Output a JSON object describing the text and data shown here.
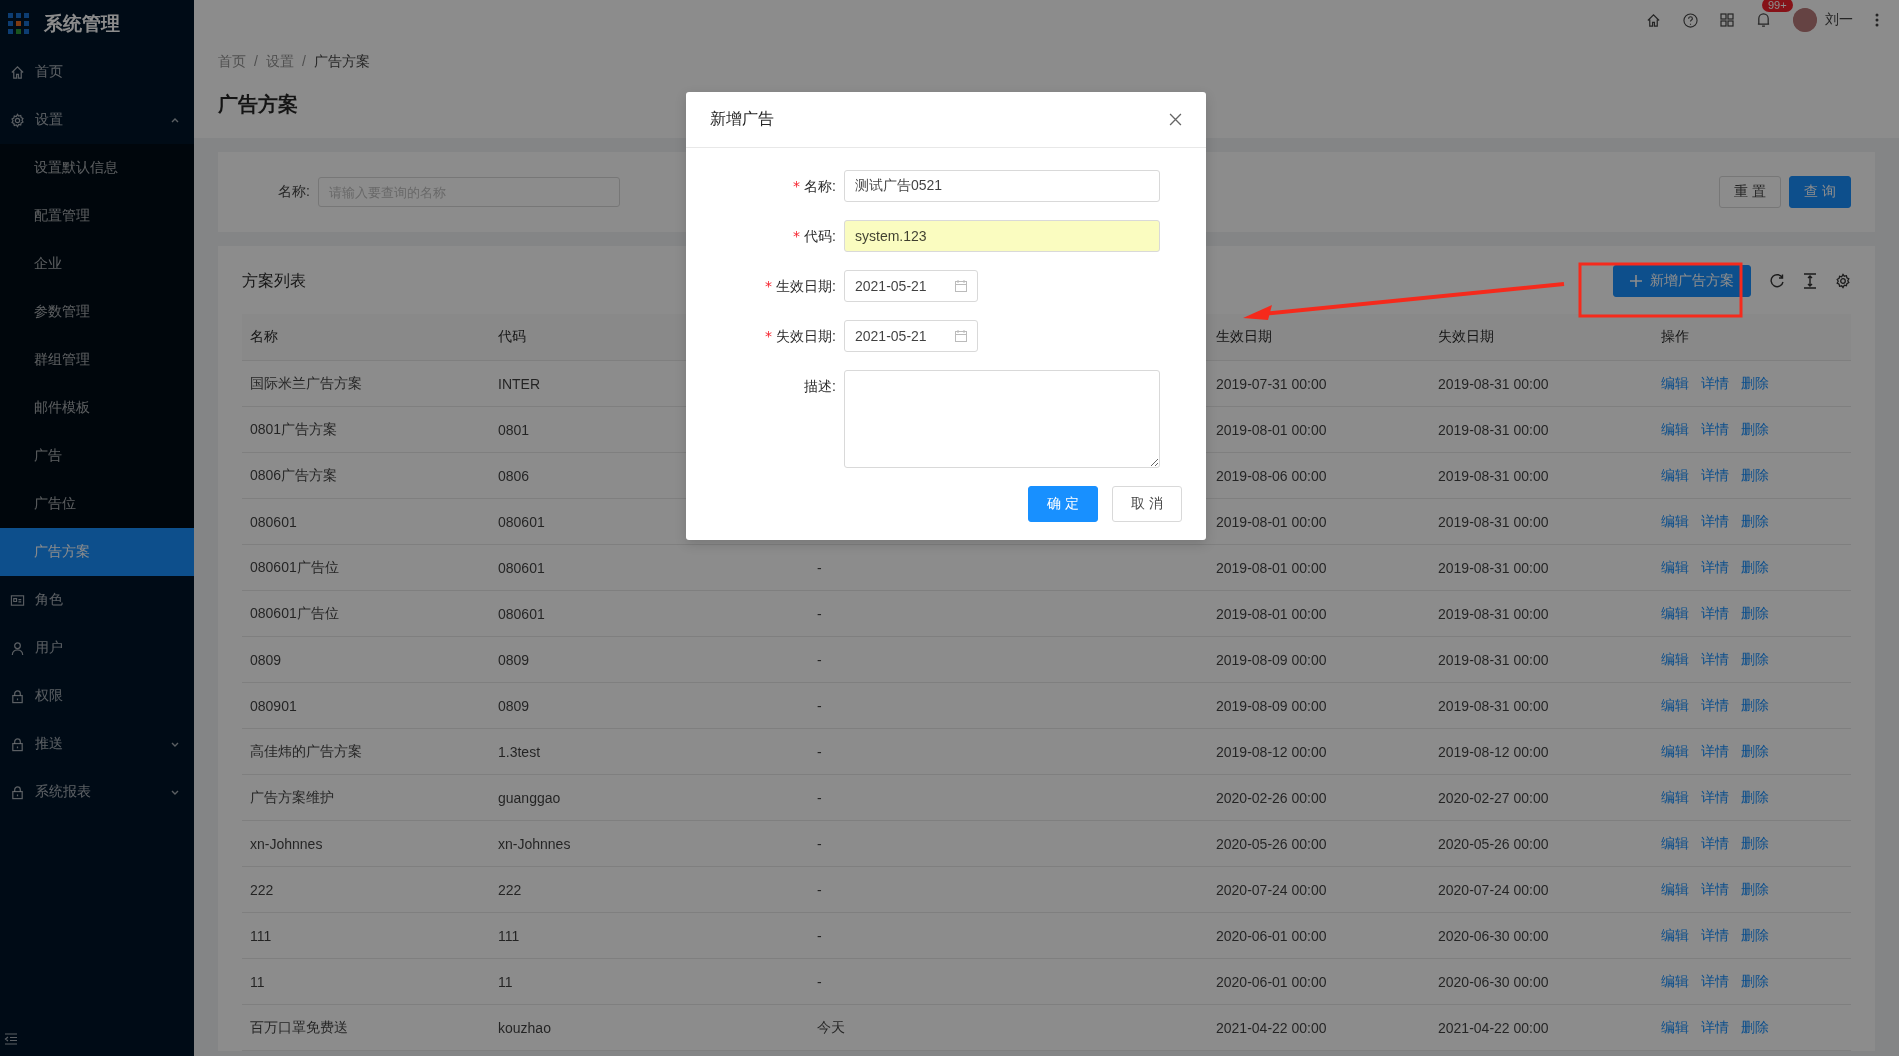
{
  "sidebar": {
    "title": "系统管理",
    "items": [
      {
        "label": "首页",
        "selected": false
      },
      {
        "label": "设置",
        "selected": false,
        "expanded": true,
        "children": [
          {
            "label": "设置默认信息",
            "selected": false
          },
          {
            "label": "配置管理",
            "selected": false
          },
          {
            "label": "企业",
            "selected": false
          },
          {
            "label": "参数管理",
            "selected": false
          },
          {
            "label": "群组管理",
            "selected": false
          },
          {
            "label": "邮件模板",
            "selected": false
          },
          {
            "label": "广告",
            "selected": false
          },
          {
            "label": "广告位",
            "selected": false
          },
          {
            "label": "广告方案",
            "selected": true
          }
        ]
      },
      {
        "label": "角色",
        "selected": false
      },
      {
        "label": "用户",
        "selected": false
      },
      {
        "label": "权限",
        "selected": false
      },
      {
        "label": "推送",
        "selected": false,
        "expanded": false
      },
      {
        "label": "系统报表",
        "selected": false,
        "expanded": false
      }
    ]
  },
  "header": {
    "notification_badge": "99+",
    "user_name": "刘一"
  },
  "breadcrumb": [
    {
      "label": "首页",
      "separator": "/"
    },
    {
      "label": "设置",
      "separator": "/"
    },
    {
      "label": "广告方案"
    }
  ],
  "page_title": "广告方案",
  "search": {
    "label": "名称:",
    "placeholder": "请输入要查询的名称",
    "buttons": [
      "重 置",
      "查 询"
    ]
  },
  "list": {
    "title": "方案列表",
    "add_button": "新增广告方案",
    "table": {
      "columns": [
        "名称",
        "代码",
        "生效日期",
        "失效日期",
        "操作"
      ],
      "rows": [
        {
          "name": "国际米兰广告方案",
          "code": "INTER",
          "start_date": "2019-07-31 00:00",
          "end_date": "2019-08-31 00:00",
          "actions": [
            "编辑",
            "详情",
            "删除"
          ]
        },
        {
          "name": "0801广告方案",
          "code": "0801",
          "start_date": "2019-08-01 00:00",
          "end_date": "2019-08-31 00:00",
          "actions": [
            "编辑",
            "详情",
            "删除"
          ]
        },
        {
          "name": "0806广告方案",
          "code": "0806",
          "start_date": "2019-08-06 00:00",
          "end_date": "2019-08-31 00:00",
          "actions": [
            "编辑",
            "详情",
            "删除"
          ]
        },
        {
          "name": "080601",
          "code": "080601",
          "start_date": "2019-08-01 00:00",
          "end_date": "2019-08-31 00:00",
          "actions": [
            "编辑",
            "详情",
            "删除"
          ]
        },
        {
          "name": "080601广告位",
          "code": "080601",
          "column_3": "-",
          "start_date": "2019-08-01 00:00",
          "end_date": "2019-08-31 00:00",
          "actions": [
            "编辑",
            "详情",
            "删除"
          ]
        },
        {
          "name": "080601广告位",
          "code": "080601",
          "column_3": "-",
          "start_date": "2019-08-01 00:00",
          "end_date": "2019-08-31 00:00",
          "actions": [
            "编辑",
            "详情",
            "删除"
          ]
        },
        {
          "name": "0809",
          "code": "0809",
          "column_3": "-",
          "start_date": "2019-08-09 00:00",
          "end_date": "2019-08-31 00:00",
          "actions": [
            "编辑",
            "详情",
            "删除"
          ]
        },
        {
          "name": "080901",
          "code": "0809",
          "column_3": "-",
          "start_date": "2019-08-09 00:00",
          "end_date": "2019-08-31 00:00",
          "actions": [
            "编辑",
            "详情",
            "删除"
          ]
        },
        {
          "name": "高佳炜的广告方案",
          "code": "1.3test",
          "column_3": "-",
          "start_date": "2019-08-12 00:00",
          "end_date": "2019-08-12 00:00",
          "actions": [
            "编辑",
            "详情",
            "删除"
          ]
        },
        {
          "name": "广告方案维护",
          "code": "guanggao",
          "column_3": "-",
          "start_date": "2020-02-26 00:00",
          "end_date": "2020-02-27 00:00",
          "actions": [
            "编辑",
            "详情",
            "删除"
          ]
        },
        {
          "name": "xn-Johnnes",
          "code": "xn-Johnnes",
          "column_3": "-",
          "start_date": "2020-05-26 00:00",
          "end_date": "2020-05-26 00:00",
          "actions": [
            "编辑",
            "详情",
            "删除"
          ]
        },
        {
          "name": "222",
          "code": "222",
          "column_3": "-",
          "start_date": "2020-07-24 00:00",
          "end_date": "2020-07-24 00:00",
          "actions": [
            "编辑",
            "详情",
            "删除"
          ]
        },
        {
          "name": "111",
          "code": "111",
          "column_3": "-",
          "start_date": "2020-06-01 00:00",
          "end_date": "2020-06-30 00:00",
          "actions": [
            "编辑",
            "详情",
            "删除"
          ]
        },
        {
          "name": "11",
          "code": "11",
          "column_3": "-",
          "start_date": "2020-06-01 00:00",
          "end_date": "2020-06-30 00:00",
          "actions": [
            "编辑",
            "详情",
            "删除"
          ]
        },
        {
          "name": "百万口罩免费送",
          "code": "kouzhao",
          "column_3": "今天",
          "start_date": "2021-04-22 00:00",
          "end_date": "2021-04-22 00:00",
          "actions": [
            "编辑",
            "详情",
            "删除"
          ]
        }
      ]
    }
  },
  "modal": {
    "title": "新增广告",
    "fields": [
      {
        "kind": "text",
        "label": "名称:",
        "required_mark": "*",
        "value": "测试广告0521",
        "autofilled": false
      },
      {
        "kind": "text",
        "label": "代码:",
        "required_mark": "*",
        "value": "system.123",
        "autofilled": true
      },
      {
        "kind": "date",
        "label": "生效日期:",
        "required_mark": "*",
        "value": "2021-05-21",
        "autofilled": false
      },
      {
        "kind": "date",
        "label": "失效日期:",
        "required_mark": "*",
        "value": "2021-05-21",
        "autofilled": false
      },
      {
        "kind": "textarea",
        "label": "描述:",
        "autofilled": false
      }
    ],
    "buttons": [
      {
        "label": "确 定",
        "primary": true
      },
      {
        "label": "取 消",
        "primary": false
      }
    ]
  }
}
